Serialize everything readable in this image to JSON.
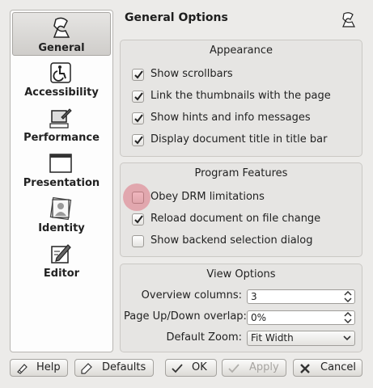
{
  "sidebar": {
    "items": [
      {
        "label": "General",
        "active": true
      },
      {
        "label": "Accessibility",
        "active": false
      },
      {
        "label": "Performance",
        "active": false
      },
      {
        "label": "Presentation",
        "active": false
      },
      {
        "label": "Identity",
        "active": false
      },
      {
        "label": "Editor",
        "active": false
      }
    ]
  },
  "page": {
    "title": "General Options"
  },
  "appearance": {
    "title": "Appearance",
    "options": [
      {
        "label": "Show scrollbars",
        "checked": true
      },
      {
        "label": "Link the thumbnails with the page",
        "checked": true
      },
      {
        "label": "Show hints and info messages",
        "checked": true
      },
      {
        "label": "Display document title in title bar",
        "checked": true
      }
    ]
  },
  "program_features": {
    "title": "Program Features",
    "options": [
      {
        "label": "Obey DRM limitations",
        "checked": false
      },
      {
        "label": "Reload document on file change",
        "checked": true
      },
      {
        "label": "Show backend selection dialog",
        "checked": false
      }
    ]
  },
  "view_options": {
    "title": "View Options",
    "overview_columns": {
      "label": "Overview columns:",
      "value": "3"
    },
    "page_overlap": {
      "label": "Page Up/Down overlap:",
      "value": "0%"
    },
    "default_zoom": {
      "label": "Default Zoom:",
      "value": "Fit Width"
    }
  },
  "buttons": {
    "help": "Help",
    "defaults": "Defaults",
    "ok": "OK",
    "apply": "Apply",
    "cancel": "Cancel"
  },
  "colors": {
    "focus_highlight": "#dc5064",
    "disabled_text": "#a6a4a0"
  }
}
